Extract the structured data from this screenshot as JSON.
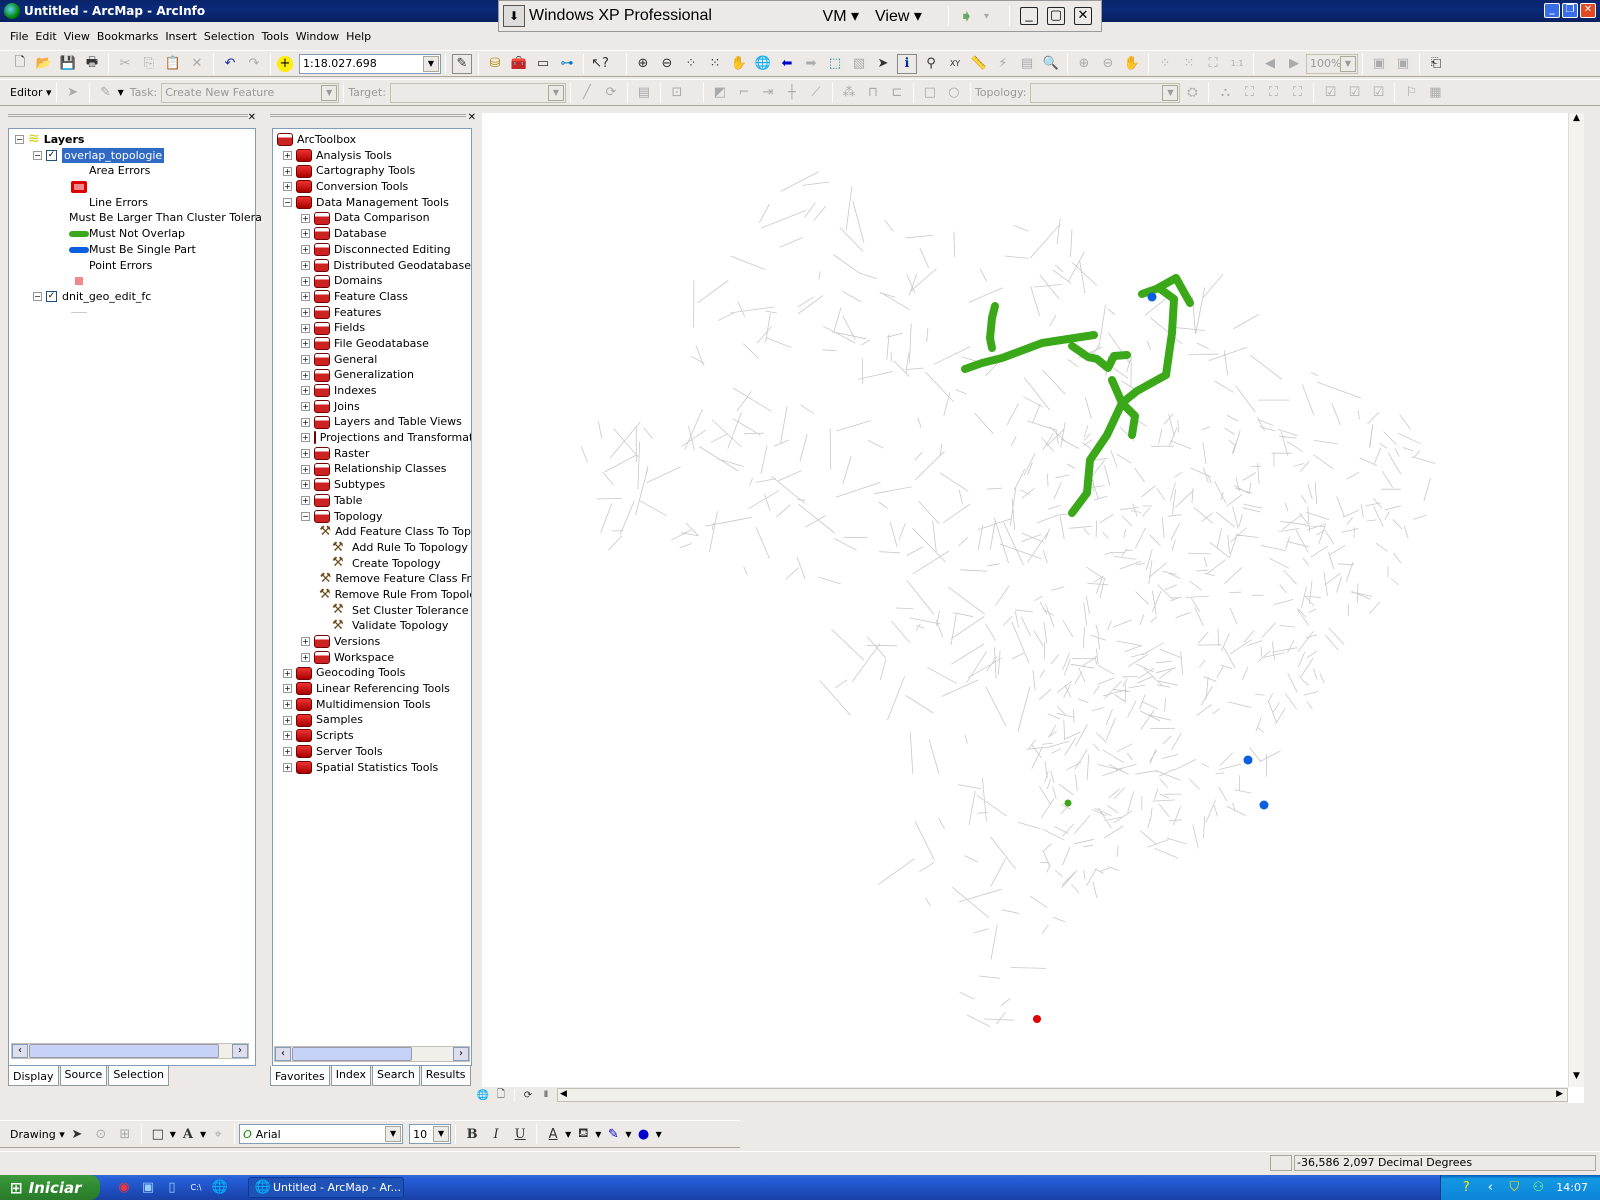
{
  "window": {
    "title": "Untitled - ArcMap - ArcInfo"
  },
  "vm_bar": {
    "title": "Windows XP Professional",
    "menu_vm": "VM",
    "menu_view": "View"
  },
  "menubar": {
    "items": [
      "File",
      "Edit",
      "View",
      "Bookmarks",
      "Insert",
      "Selection",
      "Tools",
      "Window",
      "Help"
    ]
  },
  "standard_toolbar": {
    "scale_value": "1:18.027.698"
  },
  "editor_toolbar": {
    "editor_label": "Editor",
    "task_label": "Task:",
    "task_value": "Create New Feature",
    "target_label": "Target:",
    "target_value": ""
  },
  "topology_toolbar": {
    "topology_label": "Topology:",
    "topology_value": ""
  },
  "layout_toolbar": {
    "zoom_percent": "100%"
  },
  "toc": {
    "root_label": "Layers",
    "layers": [
      {
        "name": "overlap_topologie",
        "checked": true,
        "selected": true,
        "legend": [
          {
            "label": "Area Errors",
            "kind": "header"
          },
          {
            "label": "",
            "kind": "area-swatch",
            "color": "#e00000"
          },
          {
            "label": "Line Errors",
            "kind": "header"
          },
          {
            "label": "Must Be Larger Than Cluster Tolera",
            "kind": "line-swatch",
            "color": "#e00000"
          },
          {
            "label": "Must Not Overlap",
            "kind": "line-swatch",
            "color": "#3aa818"
          },
          {
            "label": "Must Be Single Part",
            "kind": "line-swatch",
            "color": "#0a5ee0"
          },
          {
            "label": "Point Errors",
            "kind": "header"
          },
          {
            "label": "",
            "kind": "point-swatch",
            "color": "#f08a8a"
          }
        ]
      },
      {
        "name": "dnit_geo_edit_fc",
        "checked": true,
        "selected": false,
        "legend": []
      }
    ],
    "tabs": [
      "Display",
      "Source",
      "Selection"
    ],
    "active_tab": "Display"
  },
  "toolbox": {
    "root_label": "ArcToolbox",
    "items": [
      {
        "label": "Analysis Tools",
        "level": 0,
        "type": "toolbox",
        "expanded": false
      },
      {
        "label": "Cartography Tools",
        "level": 0,
        "type": "toolbox",
        "expanded": false
      },
      {
        "label": "Conversion Tools",
        "level": 0,
        "type": "toolbox",
        "expanded": false
      },
      {
        "label": "Data Management Tools",
        "level": 0,
        "type": "toolbox",
        "expanded": true
      },
      {
        "label": "Data Comparison",
        "level": 1,
        "type": "toolset",
        "expanded": false
      },
      {
        "label": "Database",
        "level": 1,
        "type": "toolset",
        "expanded": false
      },
      {
        "label": "Disconnected Editing",
        "level": 1,
        "type": "toolset",
        "expanded": false
      },
      {
        "label": "Distributed Geodatabase",
        "level": 1,
        "type": "toolset",
        "expanded": false
      },
      {
        "label": "Domains",
        "level": 1,
        "type": "toolset",
        "expanded": false
      },
      {
        "label": "Feature Class",
        "level": 1,
        "type": "toolset",
        "expanded": false
      },
      {
        "label": "Features",
        "level": 1,
        "type": "toolset",
        "expanded": false
      },
      {
        "label": "Fields",
        "level": 1,
        "type": "toolset",
        "expanded": false
      },
      {
        "label": "File Geodatabase",
        "level": 1,
        "type": "toolset",
        "expanded": false
      },
      {
        "label": "General",
        "level": 1,
        "type": "toolset",
        "expanded": false
      },
      {
        "label": "Generalization",
        "level": 1,
        "type": "toolset",
        "expanded": false
      },
      {
        "label": "Indexes",
        "level": 1,
        "type": "toolset",
        "expanded": false
      },
      {
        "label": "Joins",
        "level": 1,
        "type": "toolset",
        "expanded": false
      },
      {
        "label": "Layers and Table Views",
        "level": 1,
        "type": "toolset",
        "expanded": false
      },
      {
        "label": "Projections and Transformatio",
        "level": 1,
        "type": "toolset",
        "expanded": false
      },
      {
        "label": "Raster",
        "level": 1,
        "type": "toolset",
        "expanded": false
      },
      {
        "label": "Relationship Classes",
        "level": 1,
        "type": "toolset",
        "expanded": false
      },
      {
        "label": "Subtypes",
        "level": 1,
        "type": "toolset",
        "expanded": false
      },
      {
        "label": "Table",
        "level": 1,
        "type": "toolset",
        "expanded": false
      },
      {
        "label": "Topology",
        "level": 1,
        "type": "toolset",
        "expanded": true
      },
      {
        "label": "Add Feature Class To Top",
        "level": 2,
        "type": "tool"
      },
      {
        "label": "Add Rule To Topology",
        "level": 2,
        "type": "tool"
      },
      {
        "label": "Create Topology",
        "level": 2,
        "type": "tool"
      },
      {
        "label": "Remove Feature Class Fr",
        "level": 2,
        "type": "tool"
      },
      {
        "label": "Remove Rule From Topolo",
        "level": 2,
        "type": "tool"
      },
      {
        "label": "Set Cluster Tolerance",
        "level": 2,
        "type": "tool"
      },
      {
        "label": "Validate Topology",
        "level": 2,
        "type": "tool"
      },
      {
        "label": "Versions",
        "level": 1,
        "type": "toolset",
        "expanded": false
      },
      {
        "label": "Workspace",
        "level": 1,
        "type": "toolset",
        "expanded": false
      },
      {
        "label": "Geocoding Tools",
        "level": 0,
        "type": "toolbox",
        "expanded": false
      },
      {
        "label": "Linear Referencing Tools",
        "level": 0,
        "type": "toolbox",
        "expanded": false
      },
      {
        "label": "Multidimension Tools",
        "level": 0,
        "type": "toolbox",
        "expanded": false
      },
      {
        "label": "Samples",
        "level": 0,
        "type": "toolbox",
        "expanded": false
      },
      {
        "label": "Scripts",
        "level": 0,
        "type": "toolbox",
        "expanded": false
      },
      {
        "label": "Server Tools",
        "level": 0,
        "type": "toolbox",
        "expanded": false
      },
      {
        "label": "Spatial Statistics Tools",
        "level": 0,
        "type": "toolbox",
        "expanded": false
      }
    ],
    "tabs": [
      "Favorites",
      "Index",
      "Search",
      "Results"
    ],
    "active_tab": "Favorites"
  },
  "drawing_toolbar": {
    "drawing_label": "Drawing",
    "font_name": "Arial",
    "font_size": "10",
    "bold": "B",
    "italic": "I",
    "underline": "U"
  },
  "status": {
    "coordinates": "-36,586  2,097 Decimal Degrees"
  },
  "map": {
    "error_colors": {
      "must_not_overlap": "#3aa818",
      "must_be_single_part": "#0a5ee0",
      "must_be_larger": "#e00000"
    },
    "road_color": "#c8c8c8"
  },
  "taskbar": {
    "start_label": "Iniciar",
    "active_task": "Untitled - ArcMap - Ar...",
    "clock": "14:07"
  }
}
